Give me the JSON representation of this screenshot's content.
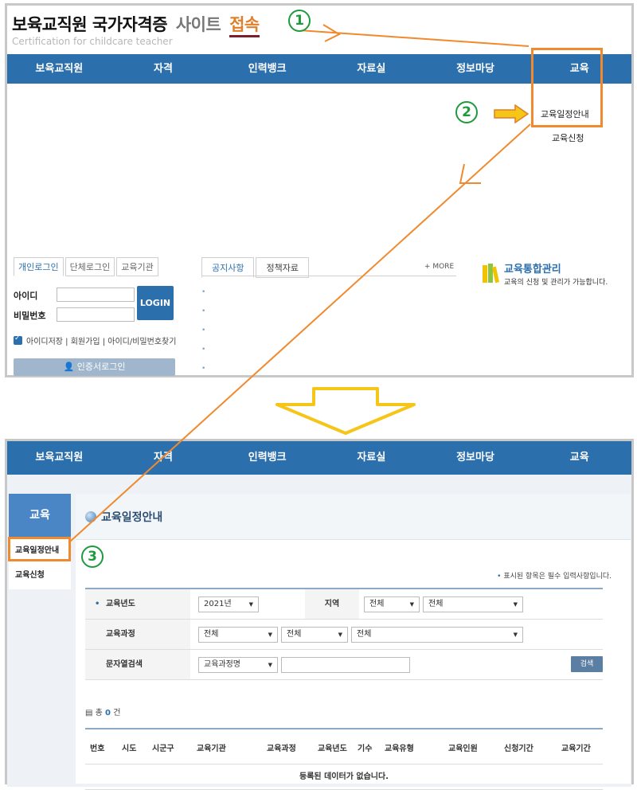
{
  "header": {
    "title_main": "보육교직원 국가자격증",
    "title_site": "사이트",
    "title_access": "접속",
    "subtitle": "Certification for childcare teacher"
  },
  "steps": [
    "1",
    "2",
    "3"
  ],
  "nav": [
    "보육교직원",
    "자격",
    "인력뱅크",
    "자료실",
    "정보마당",
    "교육"
  ],
  "dropdown": {
    "items": [
      "교육일정안내",
      "교육신청"
    ]
  },
  "login": {
    "tabs": [
      "개인로그인",
      "단체로그인",
      "교육기관"
    ],
    "id_label": "아이디",
    "pw_label": "비밀번호",
    "login_button": "LOGIN",
    "options": "아이디저장 | 회원가입 | 아이디/비밀번호찾기",
    "cert_button": "인증서로그인"
  },
  "notice": {
    "tabs": [
      "공지사항",
      "정책자료"
    ],
    "more": "+ MORE"
  },
  "edu_mgmt": {
    "title": "교육통합관리",
    "desc": "교육의 신청 및 관리가 가능합니다."
  },
  "sidebar": {
    "header": "교육",
    "items": [
      "교육일정안내",
      "교육신청"
    ]
  },
  "page": {
    "title": "교육일정안내",
    "required_note": "표시된 항목은 필수 입력사항입니다."
  },
  "form": {
    "year_label": "교육년도",
    "year_value": "2021년",
    "region_label": "지역",
    "region_value1": "전체",
    "region_value2": "전체",
    "course_label": "교육과정",
    "course_value1": "전체",
    "course_value2": "전체",
    "course_value3": "전체",
    "search_label": "문자열검색",
    "search_type": "교육과정명",
    "search_button": "검색"
  },
  "results": {
    "total_prefix": "총",
    "total_count": "0",
    "total_suffix": "건",
    "columns": [
      "번호",
      "시도",
      "시군구",
      "교육기관",
      "교육과정",
      "교육년도",
      "기수",
      "교육유형",
      "교육인원",
      "신청기간",
      "교육기간"
    ],
    "empty_message": "등록된 데이터가 없습니다."
  },
  "colors": {
    "nav_blue": "#2c6fad",
    "highlight_orange": "#f08a2e",
    "step_green": "#1e9a3f",
    "arrow_yellow": "#f5c518"
  }
}
